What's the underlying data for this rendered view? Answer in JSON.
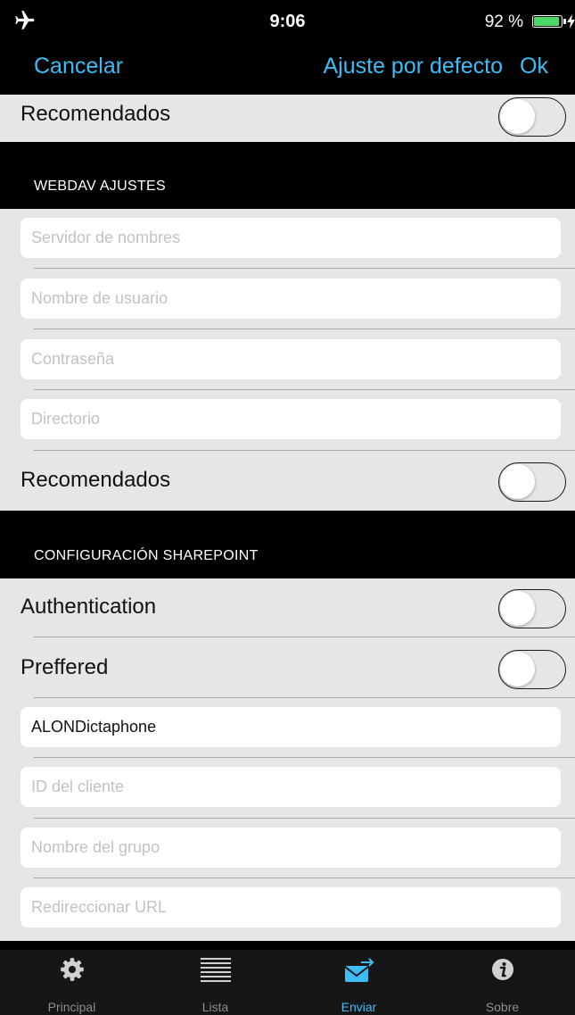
{
  "status_bar": {
    "time": "9:06",
    "battery_percent": "92 %",
    "battery_level": 0.92
  },
  "nav_bar": {
    "cancel_label": "Cancelar",
    "default_label": "Ajuste por defecto",
    "ok_label": "Ok"
  },
  "top_row": {
    "label": "Recomendados",
    "toggle_on": false
  },
  "webdav": {
    "header": "WEBDAV AJUSTES",
    "server_placeholder": "Servidor de nombres",
    "username_placeholder": "Nombre de usuario",
    "password_placeholder": "Contraseña",
    "directory_placeholder": "Directorio",
    "recommended_label": "Recomendados",
    "recommended_on": false
  },
  "sharepoint": {
    "header": "CONFIGURACIÓN SHAREPOINT",
    "authentication_label": "Authentication",
    "authentication_on": false,
    "preferred_label": "Preffered",
    "preferred_on": false,
    "app_name_value": "ALONDictaphone",
    "client_id_placeholder": "ID del cliente",
    "group_name_placeholder": "Nombre del grupo",
    "redirect_url_placeholder": "Redireccionar URL"
  },
  "tab_bar": {
    "tabs": [
      {
        "label": "Principal",
        "icon": "gear-icon"
      },
      {
        "label": "Lista",
        "icon": "list-icon"
      },
      {
        "label": "Enviar",
        "icon": "send-mail-icon"
      },
      {
        "label": "Sobre",
        "icon": "info-icon"
      }
    ],
    "active": "Enviar"
  },
  "colors": {
    "accent": "#3dbcf6",
    "row_background": "#e6e6e6",
    "battery": "#4cd964"
  }
}
